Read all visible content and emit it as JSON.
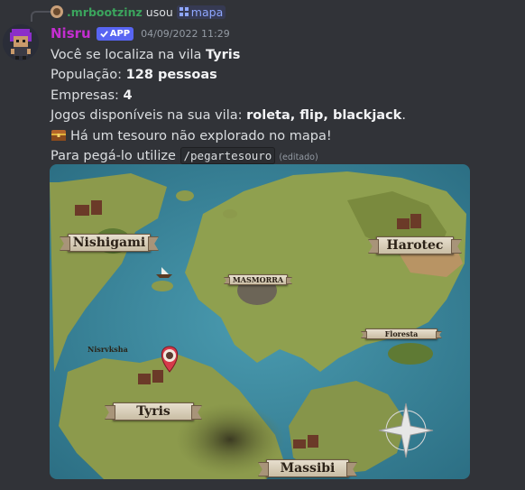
{
  "reply": {
    "username": ".mrbootzinz",
    "action": "usou",
    "command": "mapa"
  },
  "message": {
    "author": "Nisru",
    "badge": "APP",
    "timestamp": "04/09/2022 11:29",
    "lines": {
      "l1_prefix": "Você se localiza na vila ",
      "l1_bold": "Tyris",
      "l2_prefix": "População: ",
      "l2_bold": "128 pessoas",
      "l3_prefix": "Empresas: ",
      "l3_bold": "4",
      "l4_prefix": "Jogos disponíveis na sua vila: ",
      "l4_bold": "roleta, flip, blackjack",
      "l4_suffix": ".",
      "l5_text": "Há um tesouro não explorado no mapa!",
      "l6_prefix": "Para pegá-lo utilize ",
      "l6_code": "/pegartesouro",
      "edited": "(editado)"
    }
  },
  "map": {
    "labels": {
      "nishigami": "Nishigami",
      "harotec": "Harotec",
      "masmorra": "MASMORRA",
      "floresta": "Floresta",
      "nisrvksha": "Nisrvksha",
      "tyris": "Tyris",
      "massibi": "Massibi"
    }
  },
  "colors": {
    "background": "#313338",
    "username": "#c42ed0",
    "reply_user": "#3ba55d",
    "app_badge": "#5865f2",
    "sea": "#3f8aa0",
    "land": "#8a9a4a"
  }
}
